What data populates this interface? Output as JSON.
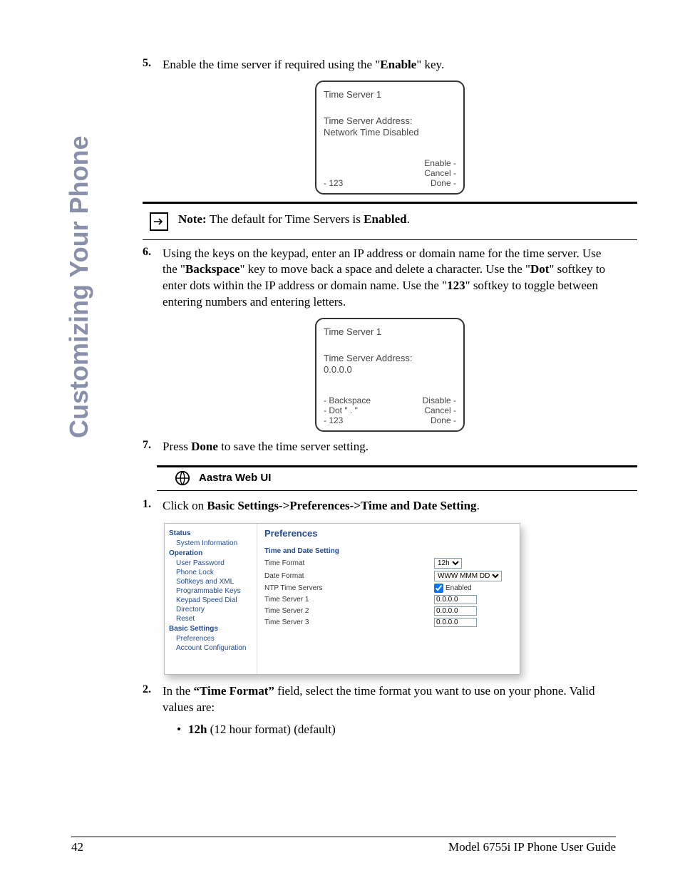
{
  "side_heading": "Customizing Your Phone",
  "steps": {
    "s5": {
      "num": "5.",
      "pre": "Enable the time server if required using the \"",
      "bold1": "Enable",
      "post": "\" key."
    },
    "s6": {
      "num": "6.",
      "pre": "Using the keys on the keypad, enter an IP address or domain name for the time server. Use the \"",
      "bold1": "Backspace",
      "mid1": "\" key to move back a space and delete a character. Use the \"",
      "bold2": "Dot",
      "mid2": "\" softkey to enter dots within the IP address or domain name. Use the \"",
      "bold3": "123",
      "post": "\" softkey to toggle between entering numbers and entering letters."
    },
    "s7": {
      "num": "7.",
      "pre": "Press ",
      "bold1": "Done",
      "post": " to save the time server setting."
    },
    "s1b": {
      "num": "1.",
      "pre": "Click on ",
      "bold1": "Basic Settings->Preferences->Time and Date Setting",
      "post": "."
    },
    "s2b": {
      "num": "2.",
      "pre": "In the ",
      "bold1": "“Time Format”",
      "post": " field, select the time format you want to use on your phone. Valid values are:"
    }
  },
  "screen1": {
    "title": "Time Server 1",
    "line1": "Time Server Address:",
    "line2": "Network Time Disabled",
    "left1": "- 123",
    "right1": "Enable -",
    "right2": "Cancel -",
    "right3": "Done -"
  },
  "note": {
    "label": "Note: ",
    "text": "The default for Time Servers is ",
    "bold": "Enabled",
    "tail": "."
  },
  "screen2": {
    "title": "Time Server 1",
    "line1": "Time Server Address:",
    "line2": "0.0.0.0",
    "left1": "- Backspace",
    "left2": "- Dot \" . \"",
    "left3": "- 123",
    "right1": "Disable -",
    "right2": "Cancel -",
    "right3": "Done -"
  },
  "section_bar": "Aastra Web UI",
  "webui": {
    "side": {
      "status": "Status",
      "sysinfo": "System Information",
      "operation": "Operation",
      "items_op": [
        "User Password",
        "Phone Lock",
        "Softkeys and XML",
        "Programmable Keys",
        "Keypad Speed Dial",
        "Directory",
        "Reset"
      ],
      "basic": "Basic Settings",
      "items_bs": [
        "Preferences",
        "Account Configuration"
      ]
    },
    "main": {
      "title": "Preferences",
      "subsection": "Time and Date Setting",
      "rows": {
        "time_format": {
          "lbl": "Time Format",
          "val": "12h"
        },
        "date_format": {
          "lbl": "Date Format",
          "val": "WWW MMM DD"
        },
        "ntp": {
          "lbl": "NTP Time Servers",
          "val": "Enabled",
          "checked": true
        },
        "ts1": {
          "lbl": "Time Server 1",
          "val": "0.0.0.0"
        },
        "ts2": {
          "lbl": "Time Server 2",
          "val": "0.0.0.0"
        },
        "ts3": {
          "lbl": "Time Server 3",
          "val": "0.0.0.0"
        }
      }
    }
  },
  "bullet1": {
    "bold": "12h",
    "text": " (12 hour format) (default)"
  },
  "footer": {
    "page": "42",
    "title": "Model 6755i IP Phone User Guide"
  }
}
